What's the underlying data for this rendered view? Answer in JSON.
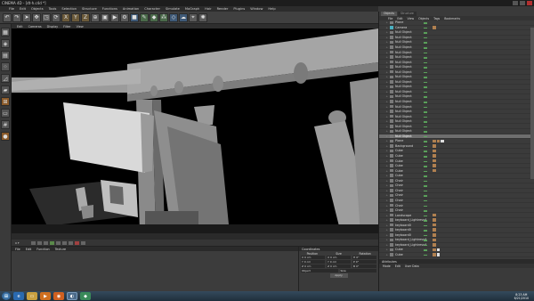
{
  "window": {
    "title": "CINEMA 4D - [dt-h.c4d *]"
  },
  "menubar": [
    "File",
    "Edit",
    "Objects",
    "Tools",
    "Selection",
    "Structure",
    "Functions",
    "Animation",
    "Character",
    "Simulate",
    "MoGraph",
    "Hair",
    "Render",
    "Plugins",
    "Window",
    "Help"
  ],
  "toolbar": [
    "undo",
    "redo",
    "pointer",
    "move",
    "scale",
    "rotate",
    "X",
    "Y",
    "Z",
    "coord",
    "render-view",
    "render",
    "render-settings",
    "cube",
    "pen",
    "subdiv",
    "array",
    "instance",
    "sky",
    "camera",
    "light"
  ],
  "viewport": {
    "menu": [
      "Edit",
      "Cameras",
      "Display",
      "Filter",
      "View"
    ]
  },
  "timeline": {
    "start_frame": "0 F",
    "current": "0 F"
  },
  "material": {
    "title": "Materials",
    "menu": [
      "File",
      "Edit",
      "Function",
      "Texture"
    ]
  },
  "coordinates": {
    "title": "Coordinates",
    "columns": [
      "Position",
      "Size",
      "Rotation"
    ],
    "rows": [
      [
        "X 0 cm",
        "X 0 cm",
        "H 0°"
      ],
      [
        "Y 0 cm",
        "Y 0 cm",
        "P 0°"
      ],
      [
        "Z 0 cm",
        "Z 0 cm",
        "B 0°"
      ]
    ],
    "mode_left": "Object",
    "mode_right": "Size",
    "apply": "Apply"
  },
  "objects_panel": {
    "tabs": [
      "Objects",
      "Structure"
    ],
    "menu": [
      "File",
      "Edit",
      "View",
      "Objects",
      "Tags",
      "Bookmarks"
    ],
    "items": [
      {
        "name": "Plane",
        "type": "n",
        "tags": 0,
        "sel": false
      },
      {
        "name": "Camera",
        "type": "c",
        "tags": 1,
        "sel": false
      },
      {
        "name": "Null Object",
        "type": "n",
        "tags": 0,
        "sel": false
      },
      {
        "name": "Null Object",
        "type": "n",
        "tags": 0,
        "sel": false
      },
      {
        "name": "Null Object",
        "type": "n",
        "tags": 0,
        "sel": false
      },
      {
        "name": "Null Object",
        "type": "n",
        "tags": 0,
        "sel": false
      },
      {
        "name": "Null Object",
        "type": "n",
        "tags": 0,
        "sel": false
      },
      {
        "name": "Null Object",
        "type": "n",
        "tags": 0,
        "sel": false
      },
      {
        "name": "Null Object",
        "type": "n",
        "tags": 0,
        "sel": false
      },
      {
        "name": "Null Object",
        "type": "n",
        "tags": 0,
        "sel": false
      },
      {
        "name": "Null Object",
        "type": "n",
        "tags": 0,
        "sel": false
      },
      {
        "name": "Null Object",
        "type": "n",
        "tags": 0,
        "sel": false
      },
      {
        "name": "Null Object",
        "type": "n",
        "tags": 0,
        "sel": false
      },
      {
        "name": "Null Object",
        "type": "n",
        "tags": 0,
        "sel": false
      },
      {
        "name": "Null Object",
        "type": "n",
        "tags": 0,
        "sel": false
      },
      {
        "name": "Null Object",
        "type": "n",
        "tags": 0,
        "sel": false
      },
      {
        "name": "Null Object",
        "type": "n",
        "tags": 0,
        "sel": false
      },
      {
        "name": "Null Object",
        "type": "n",
        "tags": 0,
        "sel": false
      },
      {
        "name": "Null Object",
        "type": "n",
        "tags": 0,
        "sel": false
      },
      {
        "name": "Null Object",
        "type": "n",
        "tags": 0,
        "sel": false
      },
      {
        "name": "Null Object",
        "type": "n",
        "tags": 0,
        "sel": false
      },
      {
        "name": "Null Object",
        "type": "n",
        "tags": 0,
        "sel": false
      },
      {
        "name": "Null Object",
        "type": "n",
        "tags": 0,
        "sel": false
      },
      {
        "name": "Null Object",
        "type": "n",
        "tags": 0,
        "sel": true
      },
      {
        "name": "Plane",
        "type": "n",
        "tags": 3,
        "sel": false
      },
      {
        "name": "Background",
        "type": "n",
        "tags": 1,
        "sel": false
      },
      {
        "name": "Cube",
        "type": "n",
        "tags": 1,
        "sel": false
      },
      {
        "name": "Cube",
        "type": "n",
        "tags": 1,
        "sel": false
      },
      {
        "name": "Cube",
        "type": "n",
        "tags": 1,
        "sel": false
      },
      {
        "name": "Cube",
        "type": "n",
        "tags": 1,
        "sel": false
      },
      {
        "name": "Cube",
        "type": "n",
        "tags": 1,
        "sel": false
      },
      {
        "name": "Cube",
        "type": "n",
        "tags": 0,
        "sel": false
      },
      {
        "name": "Chair",
        "type": "n",
        "tags": 0,
        "sel": false
      },
      {
        "name": "Chair",
        "type": "n",
        "tags": 0,
        "sel": false
      },
      {
        "name": "Chair",
        "type": "n",
        "tags": 0,
        "sel": false
      },
      {
        "name": "Chair",
        "type": "n",
        "tags": 0,
        "sel": false
      },
      {
        "name": "Chair",
        "type": "n",
        "tags": 0,
        "sel": false
      },
      {
        "name": "Chair",
        "type": "n",
        "tags": 0,
        "sel": false
      },
      {
        "name": "Chair",
        "type": "n",
        "tags": 0,
        "sel": false
      },
      {
        "name": "Landscape",
        "type": "n",
        "tags": 1,
        "sel": false
      },
      {
        "name": "keyboard_Lightrevo4",
        "type": "n",
        "tags": 1,
        "sel": false
      },
      {
        "name": "keyboard0",
        "type": "n",
        "tags": 1,
        "sel": false
      },
      {
        "name": "keyboard0",
        "type": "n",
        "tags": 1,
        "sel": false
      },
      {
        "name": "keyboard0",
        "type": "n",
        "tags": 1,
        "sel": false
      },
      {
        "name": "keyboard_Lightrevo4",
        "type": "n",
        "tags": 1,
        "sel": false
      },
      {
        "name": "keyboard_Lightrevo4",
        "type": "n",
        "tags": 1,
        "sel": false
      },
      {
        "name": "Cube",
        "type": "n",
        "tags": 2,
        "sel": false
      },
      {
        "name": "Cube",
        "type": "n",
        "tags": 2,
        "sel": false
      }
    ]
  },
  "attributes": {
    "title": "Attributes",
    "menu": [
      "Mode",
      "Edit",
      "User Data"
    ]
  },
  "taskbar": {
    "apps": [
      "ie",
      "folder",
      "media",
      "firefox",
      "cinema4d",
      "app"
    ],
    "clock_time": "8:23 AM",
    "clock_date": "6/21/2010"
  },
  "colors": {
    "selection": "#6e6e6e",
    "accent": "#d87a30"
  }
}
